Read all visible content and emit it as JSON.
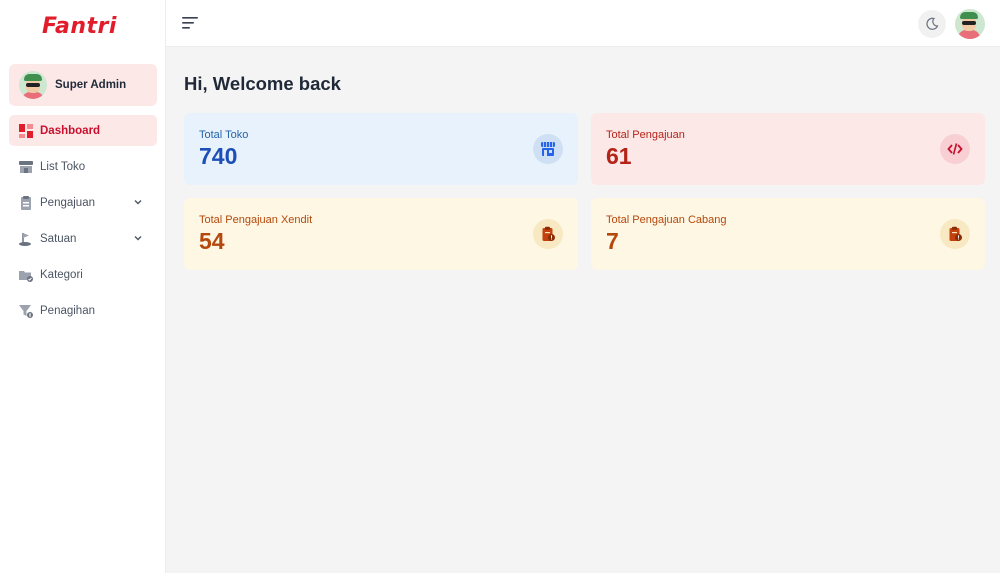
{
  "brand": {
    "logo_text": "Fantri",
    "accent": "#e11d2b"
  },
  "user": {
    "name": "Super Admin"
  },
  "sidebar": {
    "items": [
      {
        "label": "Dashboard",
        "icon": "dashboard-icon",
        "active": true
      },
      {
        "label": "List Toko",
        "icon": "store-icon"
      },
      {
        "label": "Pengajuan",
        "icon": "clipboard-icon",
        "has_submenu": true
      },
      {
        "label": "Satuan",
        "icon": "unit-icon",
        "has_submenu": true
      },
      {
        "label": "Kategori",
        "icon": "category-icon"
      },
      {
        "label": "Penagihan",
        "icon": "billing-icon"
      }
    ]
  },
  "header": {
    "menu_icon": "hamburger-icon",
    "theme_icon": "moon-icon"
  },
  "main": {
    "welcome": "Hi, Welcome back",
    "cards": [
      {
        "label": "Total Toko",
        "value": "740",
        "icon": "store-icon"
      },
      {
        "label": "Total Pengajuan",
        "value": "61",
        "icon": "code-icon"
      },
      {
        "label": "Total Pengajuan Xendit",
        "value": "54",
        "icon": "clipboard-alert-icon"
      },
      {
        "label": "Total Pengajuan Cabang",
        "value": "7",
        "icon": "clipboard-alert-icon"
      }
    ]
  }
}
